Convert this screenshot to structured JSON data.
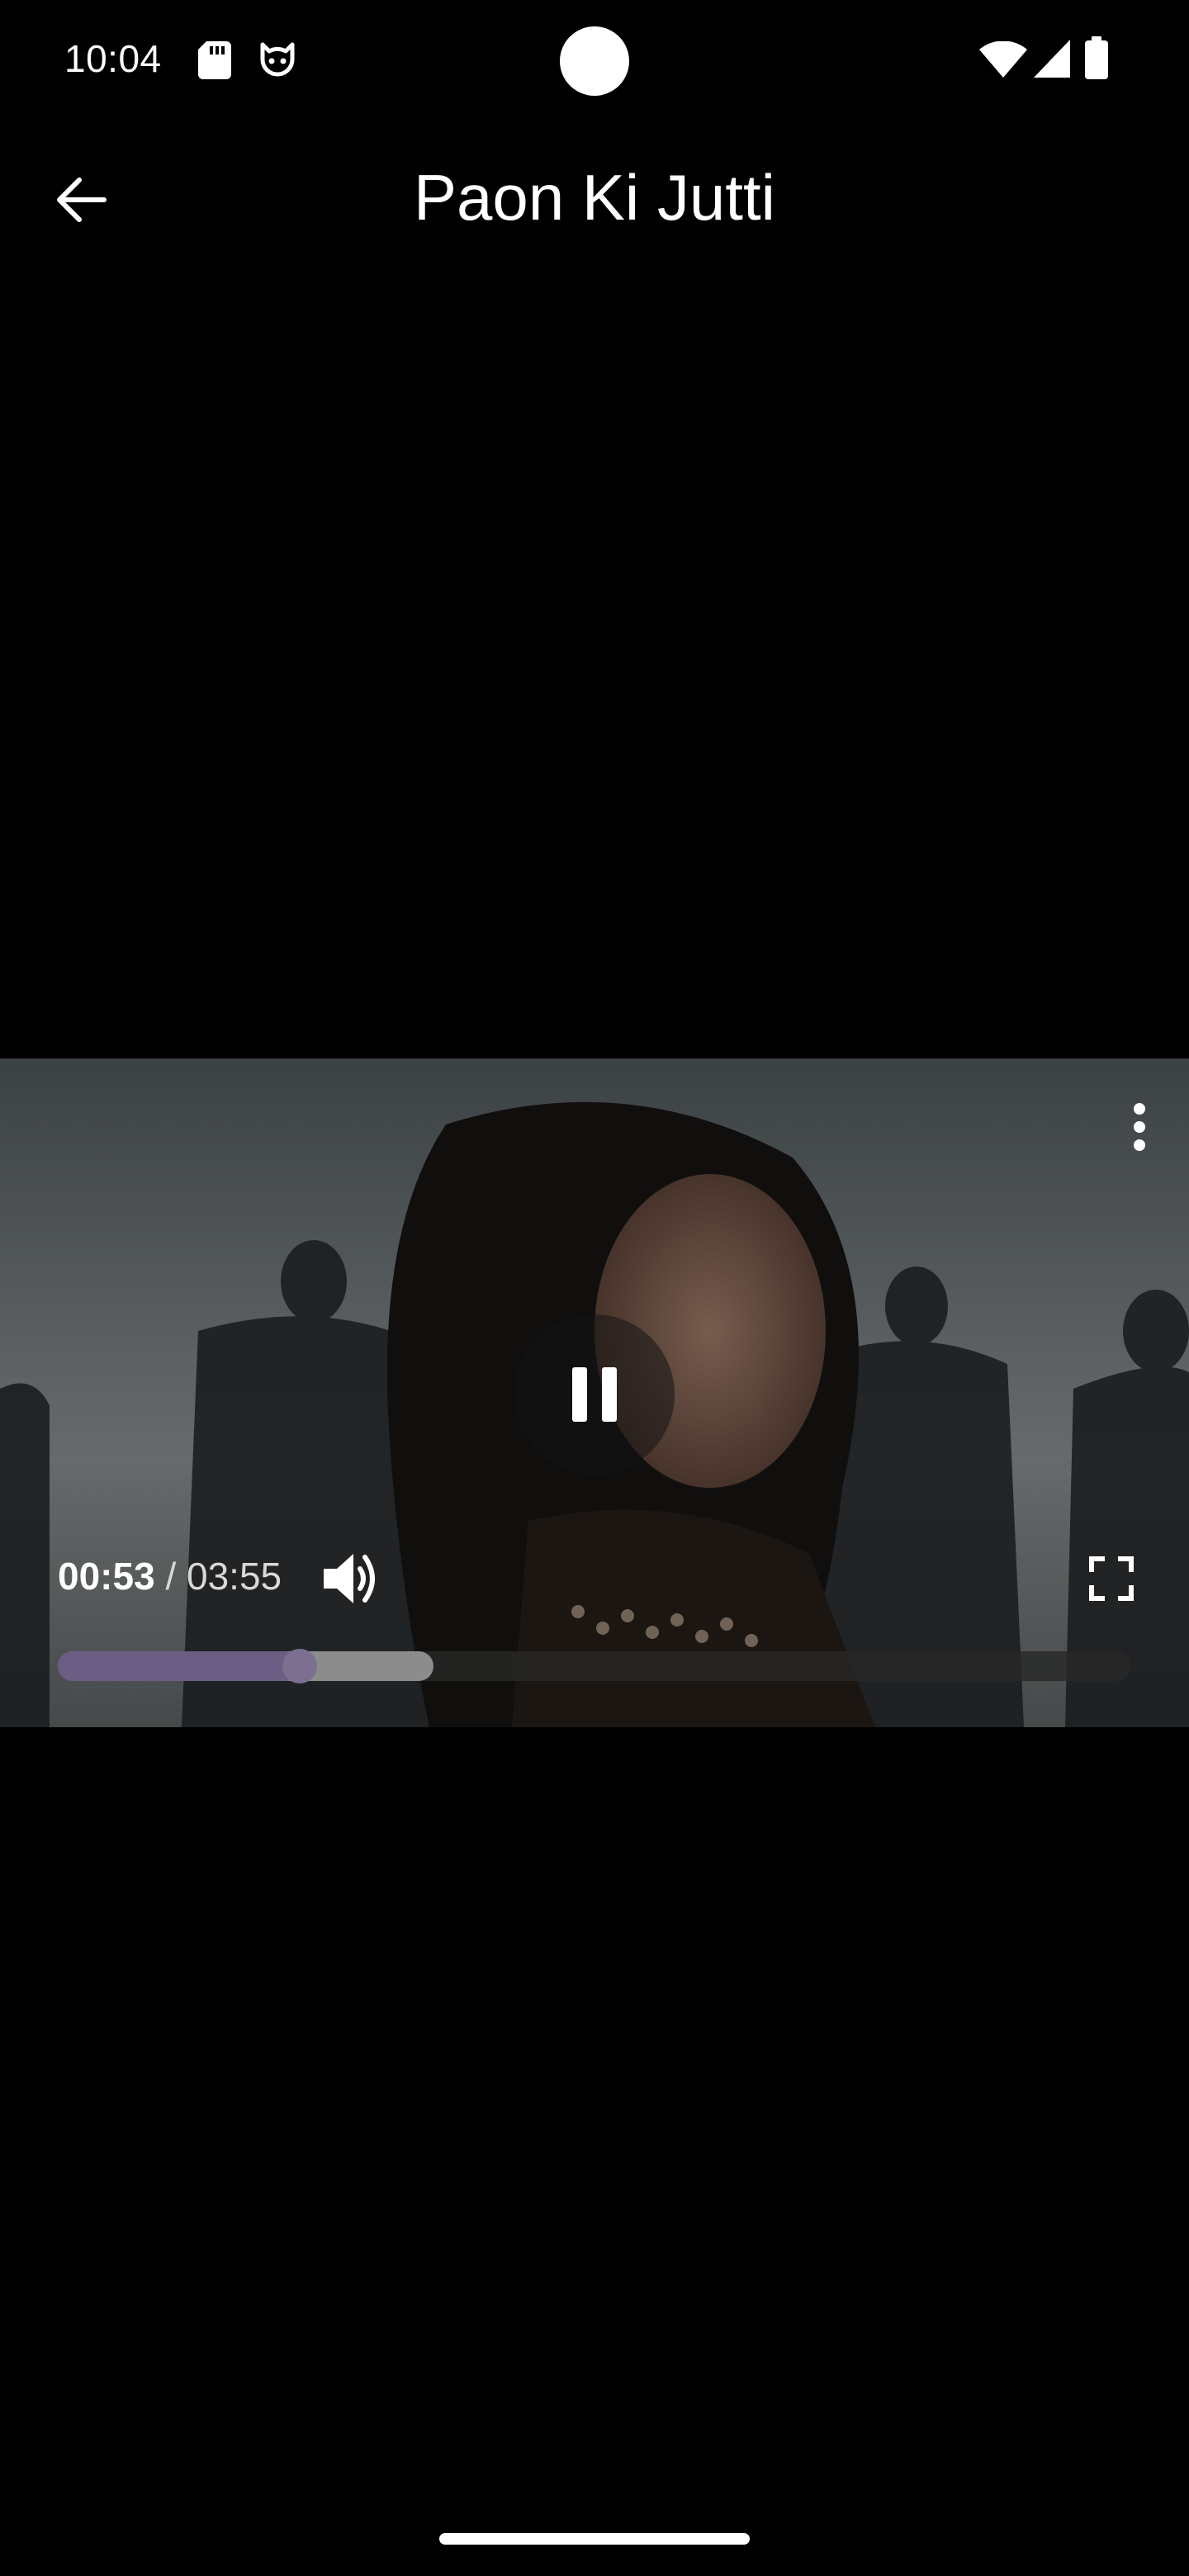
{
  "status_bar": {
    "time": "10:04",
    "left_icons": [
      "sd-card-icon",
      "cat-face-icon"
    ],
    "right_icons": [
      "wifi-icon",
      "cell-signal-icon",
      "battery-icon"
    ]
  },
  "app_bar": {
    "back_icon": "arrow-left-icon",
    "title": "Paon Ki Jutti"
  },
  "video_player": {
    "state": "playing",
    "current_time": "00:53",
    "separator": "/",
    "total_time": "03:55",
    "progress_fraction": 0.225,
    "buffered_fraction": 0.35,
    "colors": {
      "played": "#6b5d84",
      "buffered": "#8c8c8c",
      "track": "#282828"
    },
    "icons": {
      "more": "more-vert-icon",
      "pause": "pause-icon",
      "volume": "volume-up-icon",
      "fullscreen": "fullscreen-icon"
    }
  }
}
